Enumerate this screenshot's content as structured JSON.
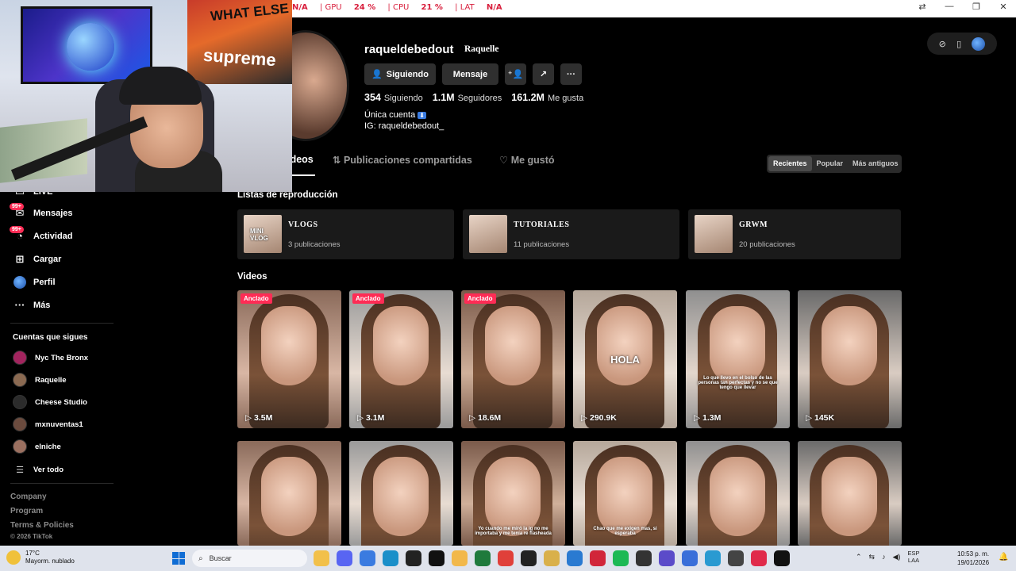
{
  "perf": {
    "items": [
      {
        "label": "N/A",
        "value": ""
      },
      {
        "label": "GPU",
        "value": "24 %"
      },
      {
        "label": "CPU",
        "value": "21 %"
      },
      {
        "label": "LAT",
        "value": "N/A"
      }
    ]
  },
  "webcam": {
    "poster_text_1": "WHAT ELSE",
    "poster_text_2": "supreme"
  },
  "sidebar": {
    "live_label": "LIVE",
    "items": [
      {
        "label": "Mensajes",
        "icon": "messages-icon",
        "badge": "99+"
      },
      {
        "label": "Actividad",
        "icon": "activity-icon",
        "badge": "99+"
      },
      {
        "label": "Cargar",
        "icon": "upload-icon"
      },
      {
        "label": "Perfil",
        "icon": "profile-icon"
      },
      {
        "label": "Más",
        "icon": "more-icon"
      }
    ],
    "following_title": "Cuentas que sigues",
    "following": [
      {
        "name": "Nyc The Bronx",
        "color": "#a2245e"
      },
      {
        "name": "Raquelle",
        "color": "#8b6a52"
      },
      {
        "name": "Cheese Studio",
        "color": "#2b2b2b"
      },
      {
        "name": "mxnuventas1",
        "color": "#6b4b3e"
      },
      {
        "name": "elniche",
        "color": "#9b7060"
      }
    ],
    "see_all": "Ver todo",
    "footer": [
      "Company",
      "Program",
      "Terms & Policies"
    ],
    "copyright": "© 2026 TikTok"
  },
  "profile": {
    "username": "raqueldebedout",
    "nickname": "Raquelle",
    "btn_following": "Siguiendo",
    "btn_message": "Mensaje",
    "stats": [
      {
        "value": "354",
        "label": "Siguiendo"
      },
      {
        "value": "1.1M",
        "label": "Seguidores"
      },
      {
        "value": "161.2M",
        "label": "Me gusta"
      }
    ],
    "bio_line1": "Única cuenta",
    "bio_arrow": "⬇",
    "bio_line2": "IG: raqueldebedout_"
  },
  "tabs": {
    "videos": "Videos",
    "reposts": "Publicaciones compartidas",
    "liked": "Me gustó"
  },
  "sort": {
    "options": [
      "Recientes",
      "Popular",
      "Más antiguos"
    ],
    "selected": "Recientes"
  },
  "playlists": {
    "title": "Listas de reproducción",
    "items": [
      {
        "name": "VLOGS",
        "count": "3 publicaciones",
        "tag": "MINI VLOG"
      },
      {
        "name": "TUTORIALES",
        "count": "11 publicaciones",
        "tag": ""
      },
      {
        "name": "GRWM",
        "count": "20 publicaciones",
        "tag": ""
      }
    ]
  },
  "videos": {
    "title": "Videos",
    "pinned_label": "Anclado",
    "row1": [
      {
        "views": "3.5M",
        "pinned": true,
        "overlay": ""
      },
      {
        "views": "3.1M",
        "pinned": true,
        "overlay": ""
      },
      {
        "views": "18.6M",
        "pinned": true,
        "overlay": ""
      },
      {
        "views": "290.9K",
        "pinned": false,
        "overlay": "HOLA"
      },
      {
        "views": "1.3M",
        "pinned": false,
        "overlay": "Lo que llevo en el bolso de las personas tan perfectas y no se que tengo que llevar"
      },
      {
        "views": "145K",
        "pinned": false,
        "overlay": ""
      }
    ],
    "row2": [
      {
        "overlay": ""
      },
      {
        "overlay": ""
      },
      {
        "overlay": "Yo cuando me miró la ig no me importaba y me tenía re flasheada"
      },
      {
        "overlay": "Chao que me exigen mas, si esperaba"
      },
      {
        "overlay": ""
      },
      {
        "overlay": ""
      }
    ]
  },
  "taskbar": {
    "weather_temp": "17°C",
    "weather_desc": "Mayorm. nublado",
    "search_placeholder": "Buscar",
    "lang_1": "ESP",
    "lang_2": "LAA",
    "time": "10:53 p. m.",
    "date": "19/01/2026",
    "apps": [
      {
        "name": "file-explorer-icon",
        "color": "#f2c04a"
      },
      {
        "name": "discord-icon",
        "color": "#5865f2"
      },
      {
        "name": "copilot-icon",
        "color": "#3a7be0"
      },
      {
        "name": "edge-icon",
        "color": "#1a8fc9"
      },
      {
        "name": "terminal-icon",
        "color": "#222222"
      },
      {
        "name": "game-icon",
        "color": "#111111"
      },
      {
        "name": "folder-icon",
        "color": "#f2b84a"
      },
      {
        "name": "upwork-icon",
        "color": "#1f7a3c"
      },
      {
        "name": "chrome-icon",
        "color": "#e0403a"
      },
      {
        "name": "capcut-icon",
        "color": "#222222"
      },
      {
        "name": "streamlabs-icon",
        "color": "#d9b04a"
      },
      {
        "name": "vscode-icon",
        "color": "#2a7ad1"
      },
      {
        "name": "opera-icon",
        "color": "#d1263a"
      },
      {
        "name": "spotify-icon",
        "color": "#1db954"
      },
      {
        "name": "obs-icon",
        "color": "#333333"
      },
      {
        "name": "app-icon",
        "color": "#5b4bc9"
      },
      {
        "name": "app2-icon",
        "color": "#3a6fd9"
      },
      {
        "name": "chrome2-icon",
        "color": "#2a9ad1"
      },
      {
        "name": "obs2-icon",
        "color": "#444444"
      },
      {
        "name": "capcut2-icon",
        "color": "#e02a4a"
      },
      {
        "name": "tiktok-icon",
        "color": "#111111"
      }
    ]
  }
}
